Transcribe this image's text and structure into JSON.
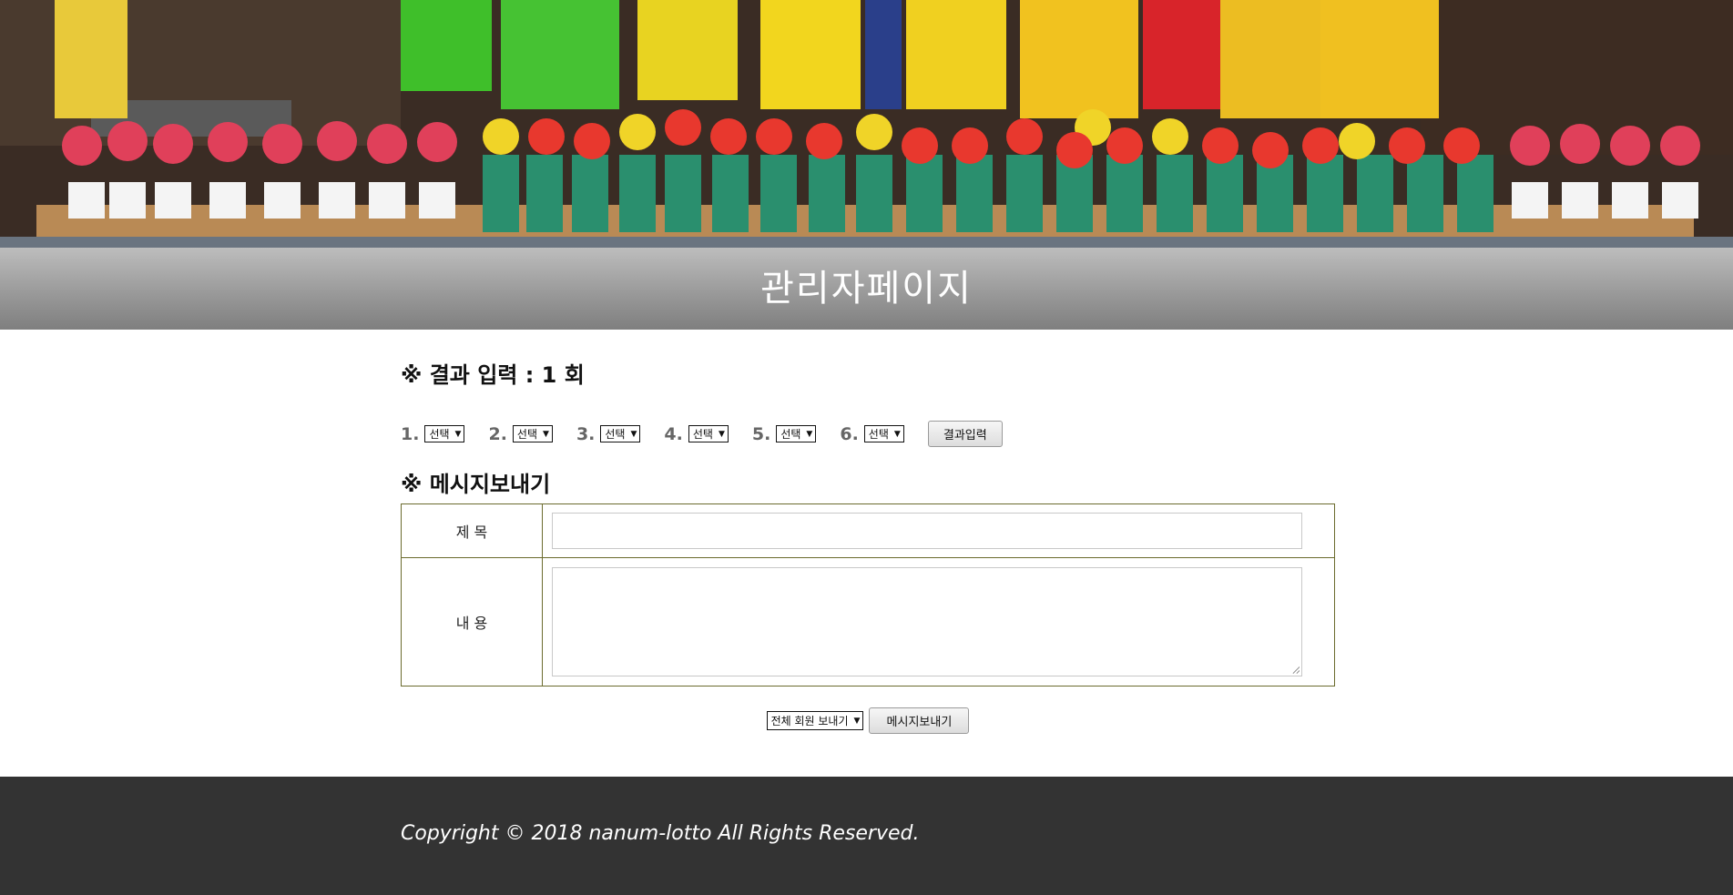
{
  "banner": {
    "alt": "volunteers with flower pots"
  },
  "page": {
    "title": "관리자페이지"
  },
  "result_section": {
    "heading": "※ 결과 입력 : 1 회",
    "picks": [
      {
        "num": "1.",
        "value": "선택"
      },
      {
        "num": "2.",
        "value": "선택"
      },
      {
        "num": "3.",
        "value": "선택"
      },
      {
        "num": "4.",
        "value": "선택"
      },
      {
        "num": "5.",
        "value": "선택"
      },
      {
        "num": "6.",
        "value": "선택"
      }
    ],
    "submit_label": "결과입력"
  },
  "message_section": {
    "heading": "※ 메시지보내기",
    "subject_label": "제 목",
    "subject_value": "",
    "content_label": "내 용",
    "content_value": "",
    "target_value": "전체 회원 보내기",
    "send_label": "메시지보내기"
  },
  "footer": {
    "copyright": "Copyright © 2018 nanum-lotto All Rights Reserved."
  },
  "colors": {
    "footer_bg": "#333333",
    "table_border": "#6b6b2e",
    "title_text": "#ffffff"
  }
}
